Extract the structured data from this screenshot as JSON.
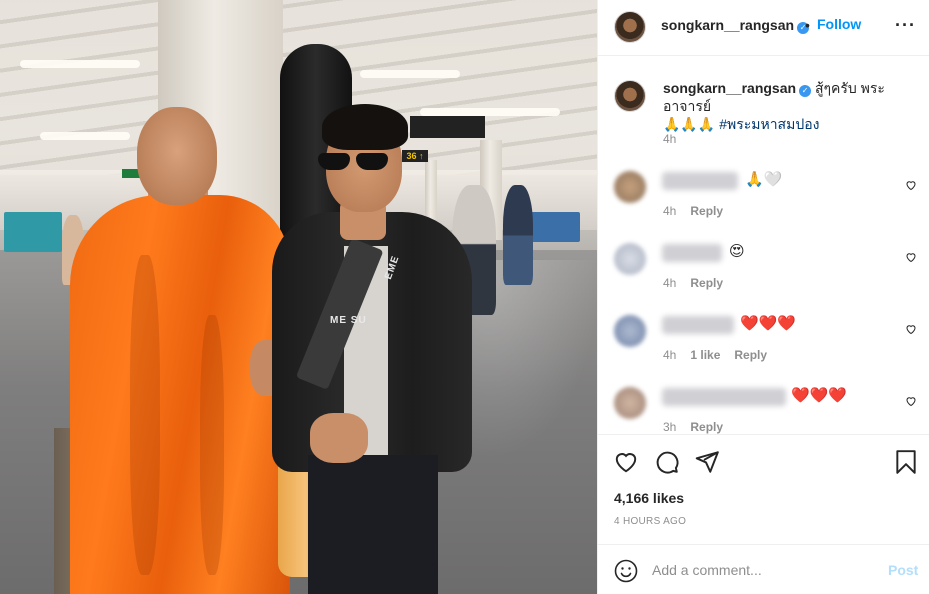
{
  "post": {
    "username": "songkarn__rangsan",
    "verified_glyph": "✓",
    "separator": "•",
    "follow_label": "Follow",
    "more_icon": "···"
  },
  "caption": {
    "username": "songkarn__rangsan",
    "text": "สู้ๆครับ พระอาจารย์",
    "emoji": "🙏🙏🙏",
    "hashtag": "#พระมหาสมปอง",
    "time": "4h"
  },
  "comments": [
    {
      "emoji": "🙏🤍",
      "time": "4h",
      "likes": "",
      "reply_label": "Reply"
    },
    {
      "emoji": "😍",
      "time": "4h",
      "likes": "",
      "reply_label": "Reply"
    },
    {
      "emoji": "❤️❤️❤️",
      "time": "4h",
      "likes": "1 like",
      "reply_label": "Reply"
    },
    {
      "emoji": "❤️❤️❤️",
      "time": "3h",
      "likes": "",
      "reply_label": "Reply"
    }
  ],
  "actions": {
    "like_icon": "heart-icon",
    "comment_icon": "comment-icon",
    "share_icon": "send-icon",
    "save_icon": "bookmark-icon",
    "likes_text": "4,166 likes",
    "time_ago": "4 HOURS AGO"
  },
  "add_comment": {
    "placeholder": "Add a comment...",
    "post_label": "Post"
  },
  "photo": {
    "bag_text_1": "EME",
    "bag_text_2": "ME SU",
    "strap_text": "EME SU",
    "gate_sign": "36 ↑"
  },
  "colors": {
    "accent": "#0095f6",
    "verified": "#3897f0",
    "robe": "#f06a12",
    "post_disabled": "#b2dffc"
  }
}
